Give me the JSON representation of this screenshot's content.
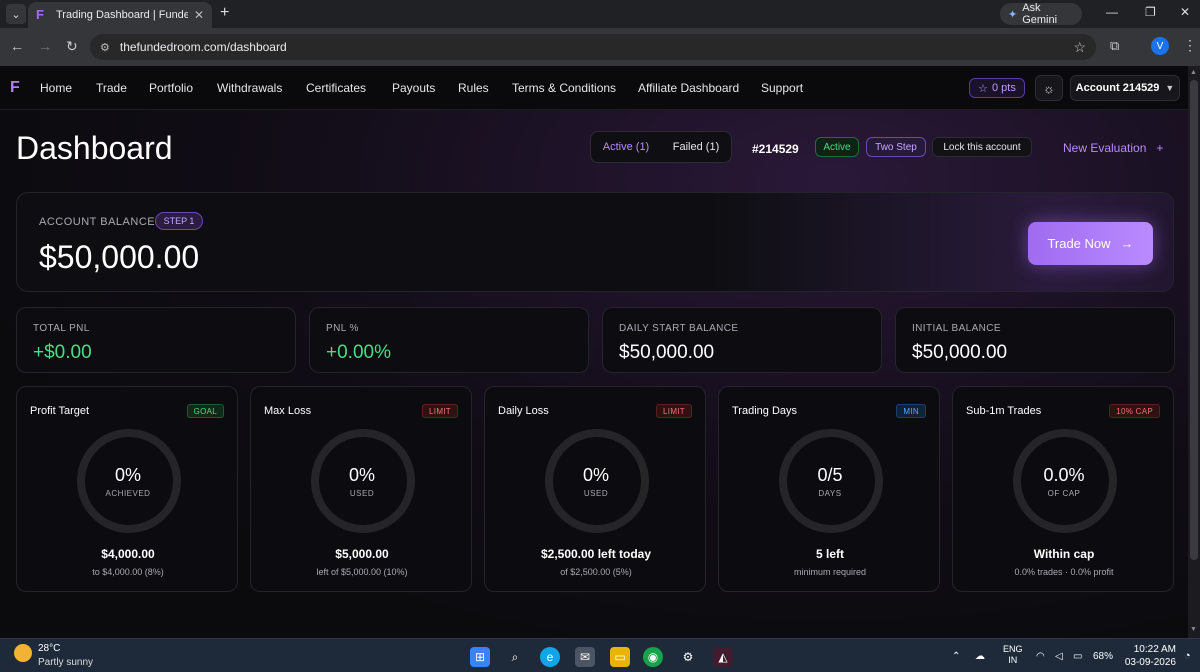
{
  "browser": {
    "tab_title": "Trading Dashboard | Funded Ro",
    "url": "thefundedroom.com/dashboard",
    "ask_gemini": "Ask Gemini",
    "profile_initial": "V"
  },
  "nav": {
    "items": [
      "Home",
      "Trade",
      "Portfolio",
      "Withdrawals",
      "Certificates",
      "Payouts",
      "Rules",
      "Terms & Conditions",
      "Affiliate Dashboard",
      "Support"
    ],
    "points": "0 pts",
    "account": "Account 214529"
  },
  "header": {
    "title": "Dashboard",
    "filter_active": "Active (1)",
    "filter_failed": "Failed (1)",
    "account_id": "#214529",
    "status_badge": "Active",
    "phase_badge": "Two Step",
    "lock_label": "Lock this account",
    "new_evaluation": "New Evaluation",
    "new_evaluation_icon": "+"
  },
  "balance": {
    "label": "ACCOUNT BALANCE",
    "step": "STEP 1",
    "value": "$50,000.00",
    "trade_now": "Trade Now",
    "trade_now_icon": "→"
  },
  "stats": [
    {
      "label": "TOTAL PNL",
      "value": "+$0.00"
    },
    {
      "label": "PNL %",
      "value": "+0.00%"
    },
    {
      "label": "DAILY START BALANCE",
      "value": "$50,000.00"
    },
    {
      "label": "INITIAL BALANCE",
      "value": "$50,000.00"
    }
  ],
  "metrics": [
    {
      "title": "Profit Target",
      "tag": "GOAL",
      "value": "0%",
      "sub": "ACHIEVED",
      "amount": "$4,000.00",
      "note": "to $4,000.00 (8%)"
    },
    {
      "title": "Max Loss",
      "tag": "LIMIT",
      "value": "0%",
      "sub": "USED",
      "amount": "$5,000.00",
      "note": "left of $5,000.00 (10%)"
    },
    {
      "title": "Daily Loss",
      "tag": "LIMIT",
      "value": "0%",
      "sub": "USED",
      "amount": "$2,500.00 left today",
      "note": "of $2,500.00 (5%)"
    },
    {
      "title": "Trading Days",
      "tag": "MIN",
      "value": "0/5",
      "sub": "DAYS",
      "amount": "5 left",
      "note": "minimum required"
    },
    {
      "title": "Sub-1m Trades",
      "tag": "10% CAP",
      "value": "0.0%",
      "sub": "OF CAP",
      "amount": "Within cap",
      "note": "0.0% trades · 0.0% profit"
    }
  ],
  "taskbar": {
    "temperature": "28°C",
    "weather": "Partly sunny",
    "lang_1": "ENG",
    "lang_2": "IN",
    "battery": "68%",
    "time": "10:22 AM",
    "date": "03-09-2026"
  },
  "colors": {
    "accent": "#b98bff",
    "positive": "#4ade80",
    "limit": "#f87171",
    "info": "#60a5fa"
  }
}
